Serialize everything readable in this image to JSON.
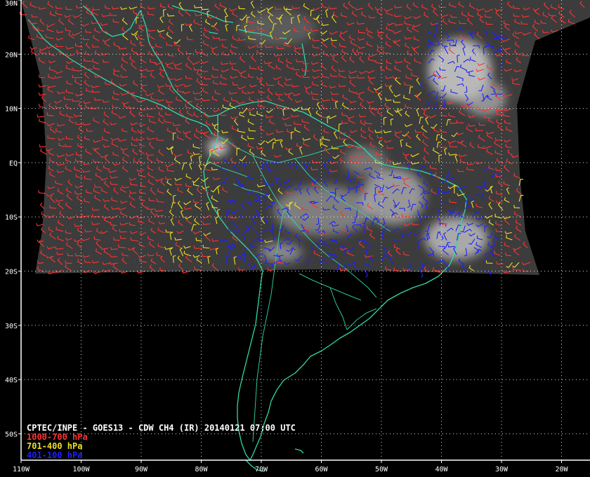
{
  "title": "CPTEC/INPE - GOES13 - CDW CH4 (IR) 20140121 07:00 UTC",
  "legend": [
    {
      "label": "1000-700 hPa",
      "color": "#ff3333"
    },
    {
      "label": "701-400 hPa",
      "color": "#f0e020"
    },
    {
      "label": "401-100 hPa",
      "color": "#2020ff"
    }
  ],
  "lat_labels": [
    "30N",
    "20N",
    "10N",
    "EQ",
    "10S",
    "20S",
    "30S",
    "40S",
    "50S"
  ],
  "lon_labels": [
    "110W",
    "100W",
    "90W",
    "80W",
    "70W",
    "60W",
    "50W",
    "40W",
    "30W",
    "20W"
  ],
  "colors": {
    "background": "#000000",
    "imagery": "#3c3c3c",
    "coastline": "#30d8a8",
    "grid": "#ffffff",
    "frame": "#ffffff"
  }
}
